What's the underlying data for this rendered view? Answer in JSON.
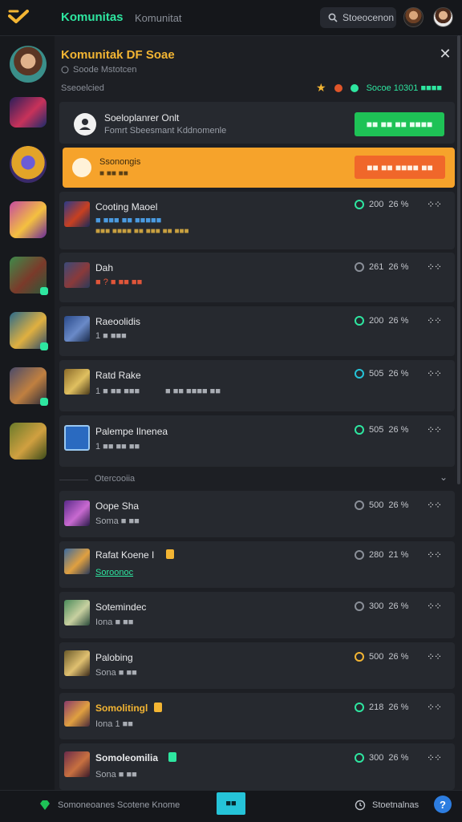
{
  "topbar": {
    "title": "Komunitas",
    "subtitle": "Komunitat",
    "search_label": "Stoeocenon",
    "avatars": [
      "profile-avatar-1",
      "profile-avatar-2"
    ]
  },
  "panel": {
    "title": "Komunitak DF Soae",
    "subtitle": "Soode Mstotcen",
    "section_label": "Sseoelcied",
    "stats_text": "Socoe 10301 ■■■■"
  },
  "notice": {
    "title": "Soeloplanrer Onlt",
    "text": "Fomrt Sbeesmant Kddnomenle",
    "button": "■■ ■■ ■■ ■■■■"
  },
  "promo": {
    "title": "Ssonongis",
    "text": "■ ■■ ■■",
    "button": "■■ ■■ ■■■■ ■■"
  },
  "rows": [
    {
      "name": "Cooting Maoel",
      "sub": "■ ■■■ ■■ ■■■■■",
      "sub2": "■■■ ■■■■ ■■ ■■■ ■■ ■■■",
      "count": "200",
      "time": "26 %",
      "ring": "#2ee6a0"
    },
    {
      "name": "Dah",
      "sub": "■ ? ■ ■■ ■■",
      "count": "261",
      "time": "26 %",
      "ring": "#8a8f98"
    },
    {
      "name": "Raeoolidis",
      "sub": "1 ■ ■■■",
      "count": "200",
      "time": "26 %",
      "ring": "#2ee6a0"
    },
    {
      "name": "Ratd Rake",
      "sub": "1 ■ ■■ ■■■",
      "sub_extra": "■ ■■ ■■■■ ■■",
      "count": "505",
      "time": "26 %",
      "ring": "#25c3d8"
    },
    {
      "name": "Palempe Ilnenea",
      "sub": "1 ■■ ■■ ■■",
      "count": "505",
      "time": "26 %",
      "ring": "#2ee6a0"
    },
    {
      "name": "Oope Sha",
      "sub": "Soma ■ ■■",
      "count": "500",
      "time": "26 %",
      "ring": "#8a8f98"
    },
    {
      "name": "Rafat Koene I",
      "sub": "Soroonoc",
      "count": "280",
      "time": "21 %",
      "ring": "#8a8f98"
    },
    {
      "name": "Sotemindec",
      "sub": "Iona ■ ■■",
      "count": "300",
      "time": "26 %",
      "ring": "#8a8f98"
    },
    {
      "name": "Palobing",
      "sub": "Sona ■ ■■",
      "count": "500",
      "time": "26 %",
      "ring": "#f3b533"
    },
    {
      "name": "Somolitingl",
      "sub": "Iona 1 ■■",
      "count": "218",
      "time": "26 %",
      "ring": "#2ee6a0"
    },
    {
      "name": "Somoleomilia",
      "sub": "Sona ■ ■■",
      "count": "300",
      "time": "26 %",
      "ring": "#2ee6a0"
    }
  ],
  "divider_label": "Otercooiia",
  "bottombar": {
    "left_text": "Somoneoanes  Scotene Knome",
    "mid_button": "■■",
    "right_text": "Stoetnalnas",
    "help": "?"
  }
}
